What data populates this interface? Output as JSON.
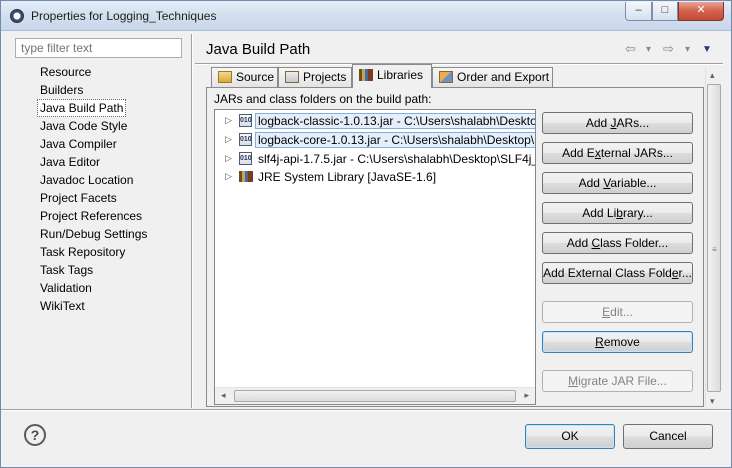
{
  "window": {
    "title": "Properties for Logging_Techniques",
    "controls": {
      "minimize": "–",
      "maximize": "□",
      "close": "✕"
    }
  },
  "filter": {
    "placeholder": "type filter text",
    "value": ""
  },
  "nav": {
    "selected": "Java Build Path",
    "items": [
      "Resource",
      "Builders",
      "Java Build Path",
      "Java Code Style",
      "Java Compiler",
      "Java Editor",
      "Javadoc Location",
      "Project Facets",
      "Project References",
      "Run/Debug Settings",
      "Task Repository",
      "Task Tags",
      "Validation",
      "WikiText"
    ]
  },
  "page": {
    "title": "Java Build Path",
    "history": {
      "back": "⇦",
      "back_menu": "▾",
      "forward": "⇨",
      "forward_menu": "▾",
      "view_menu": "▼"
    }
  },
  "tabs": [
    {
      "label": "Source",
      "icon": "source-folder-icon",
      "active": false
    },
    {
      "label": "Projects",
      "icon": "projects-icon",
      "active": false
    },
    {
      "label": "Libraries",
      "icon": "libraries-icon",
      "active": true
    },
    {
      "label": "Order and Export",
      "icon": "order-export-icon",
      "active": false
    }
  ],
  "libraries": {
    "label": "JARs and class folders on the build path:",
    "entries": [
      {
        "text": "logback-classic-1.0.13.jar - C:\\Users\\shalabh\\Deskto",
        "icon": "jar-icon",
        "selected": true
      },
      {
        "text": "logback-core-1.0.13.jar - C:\\Users\\shalabh\\Desktop\\",
        "icon": "jar-icon",
        "selected": true
      },
      {
        "text": "slf4j-api-1.7.5.jar - C:\\Users\\shalabh\\Desktop\\SLF4j_",
        "icon": "jar-icon",
        "selected": false
      },
      {
        "text": "JRE System Library [JavaSE-1.6]",
        "icon": "library-icon",
        "selected": false
      }
    ],
    "expand_glyph": "▷",
    "scroll": {
      "left": "◂",
      "right": "▸",
      "up": "▴",
      "down": "▾",
      "grip": "≡"
    }
  },
  "buttons": {
    "add_jars": {
      "pre": "Add ",
      "u": "J",
      "post": "ARs..."
    },
    "add_external_jars": {
      "pre": "Add E",
      "u": "x",
      "post": "ternal JARs..."
    },
    "add_variable": {
      "pre": "Add ",
      "u": "V",
      "post": "ariable..."
    },
    "add_library": {
      "pre": "Add Li",
      "u": "b",
      "post": "rary..."
    },
    "add_class_folder": {
      "pre": "Add ",
      "u": "C",
      "post": "lass Folder..."
    },
    "add_external_class_folder": {
      "pre": "Add External Class Fold",
      "u": "e",
      "post": "r..."
    },
    "edit": {
      "pre": "",
      "u": "E",
      "post": "dit..."
    },
    "remove": {
      "pre": "",
      "u": "R",
      "post": "emove"
    },
    "migrate_jar": {
      "pre": "",
      "u": "M",
      "post": "igrate JAR File..."
    }
  },
  "footer": {
    "help": "?",
    "ok": "OK",
    "cancel": "Cancel"
  }
}
